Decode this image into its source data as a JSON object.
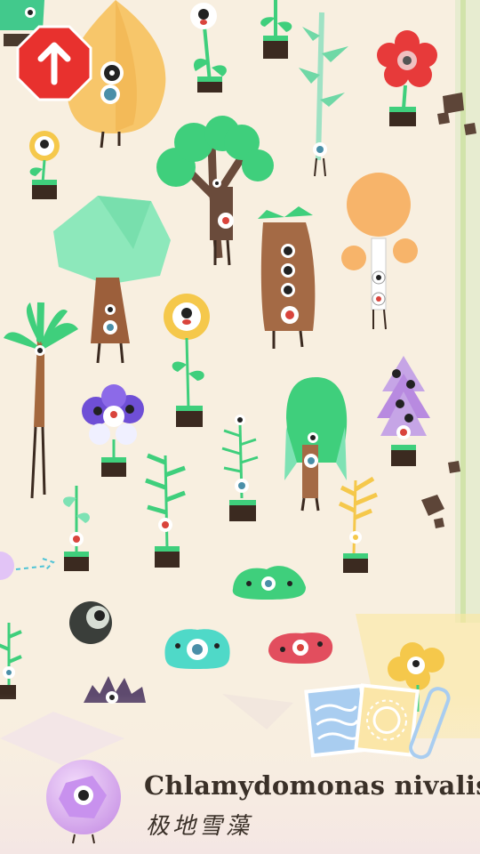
{
  "species": {
    "latin_name": "Chlamydomonas nivalis",
    "chinese_name": "极地雪藻"
  },
  "controls": {
    "up_button_icon": "arrow-up-icon",
    "journal_icon": "journal-cards-icon",
    "selected_creature_icon": "purple-bubble-creature-icon"
  },
  "colors": {
    "background": "#f8efe0",
    "up_button": "#e8312e",
    "text": "#3a3028"
  }
}
